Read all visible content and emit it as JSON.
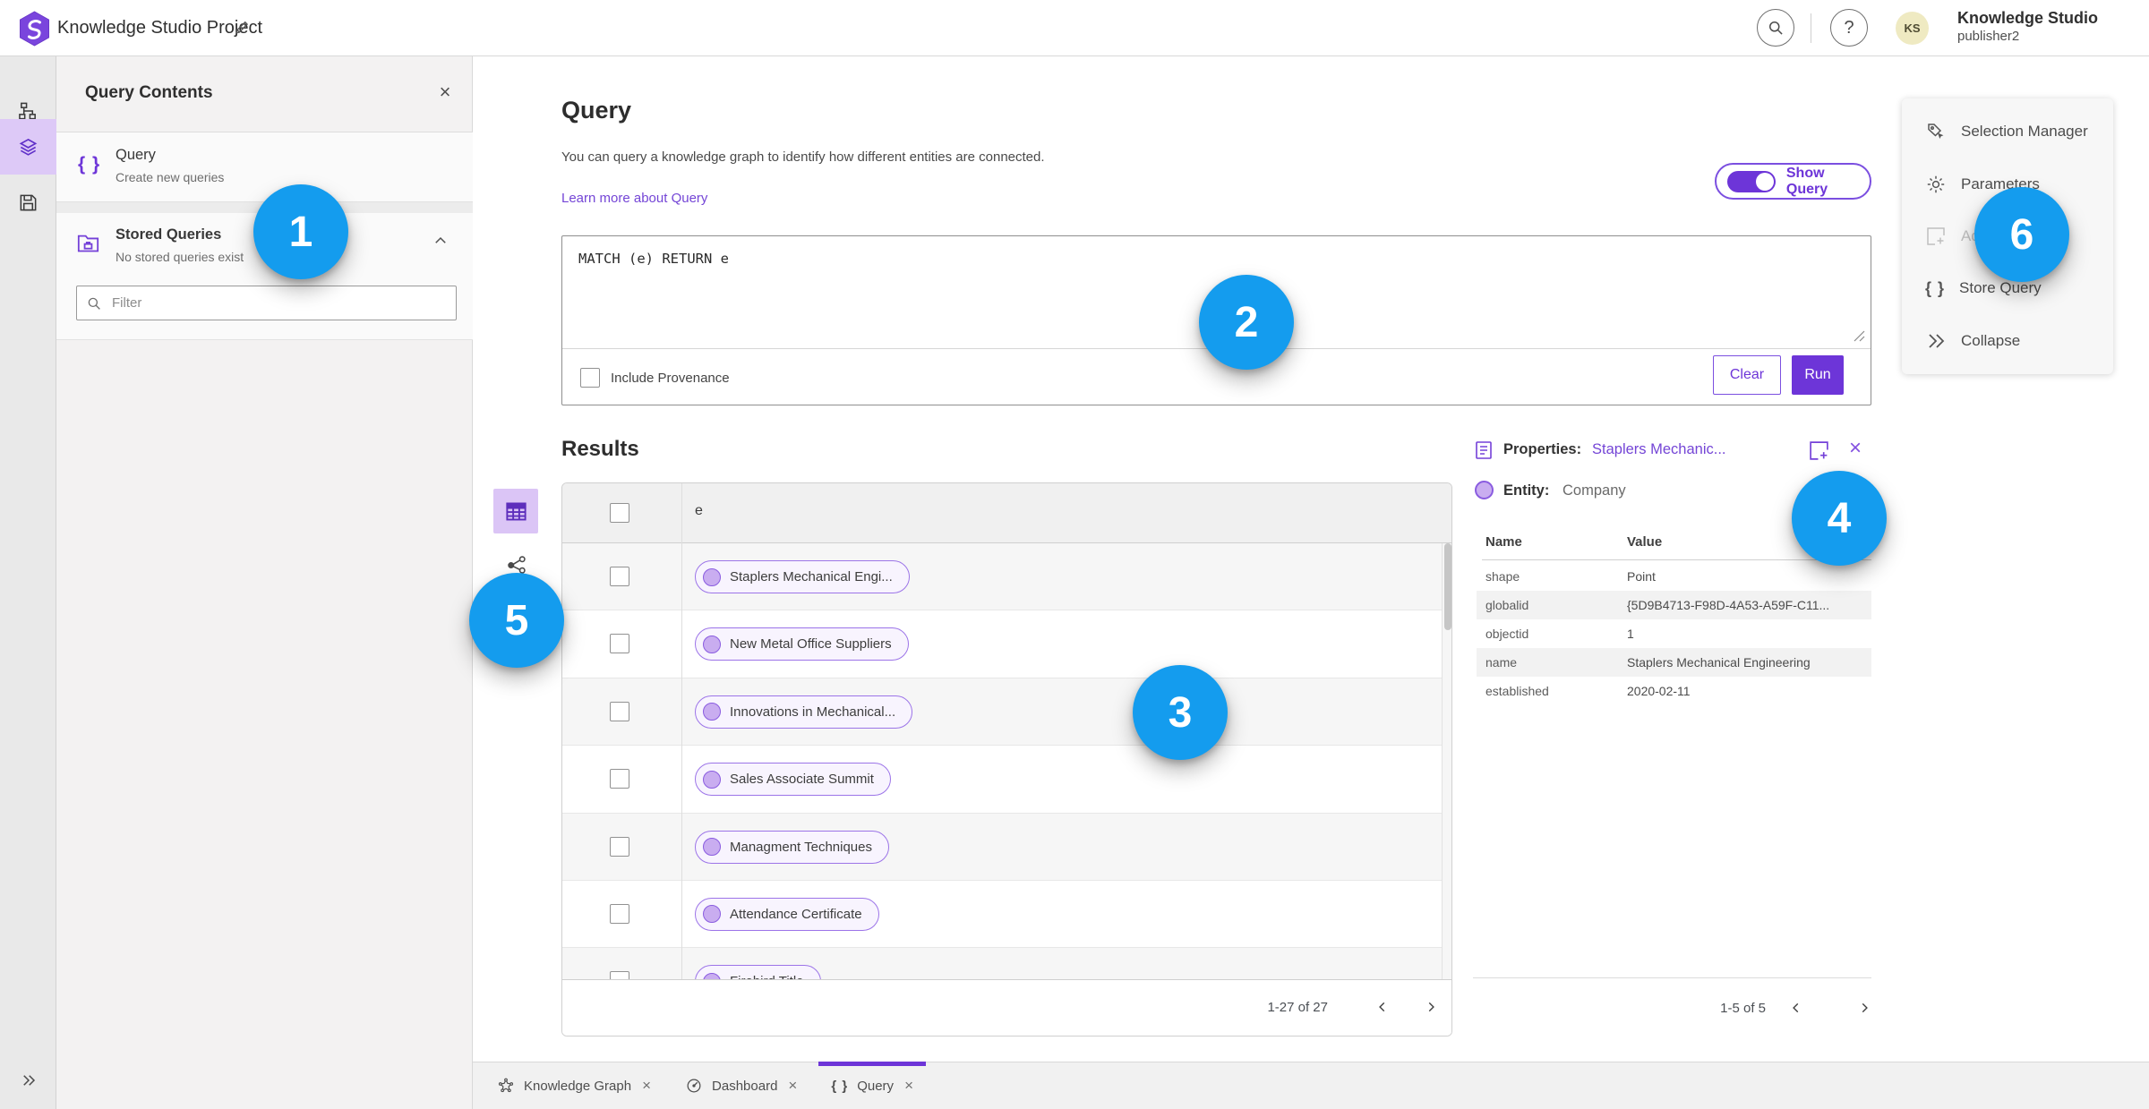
{
  "app": {
    "title": "Knowledge Studio Project",
    "user_initials": "KS",
    "user_name": "Knowledge Studio",
    "user_role": "publisher2"
  },
  "left_panel": {
    "title": "Query Contents",
    "query_item": {
      "title": "Query",
      "subtitle": "Create new queries"
    },
    "stored_item": {
      "title": "Stored Queries",
      "subtitle": "No stored queries exist"
    },
    "filter_placeholder": "Filter"
  },
  "query_section": {
    "heading": "Query",
    "description": "You can query a knowledge graph to identify how different entities are connected.",
    "learn_link": "Learn more about Query",
    "show_query_label": "Show Query",
    "query_text": "MATCH (e) RETURN e",
    "provenance_label": "Include Provenance",
    "clear_label": "Clear",
    "run_label": "Run"
  },
  "results": {
    "heading": "Results",
    "column_header": "e",
    "rows": [
      "Staplers Mechanical Engi...",
      "New Metal Office Suppliers",
      "Innovations in Mechanical...",
      "Sales Associate Summit",
      "Managment Techniques",
      "Attendance Certificate",
      "Firebird Title"
    ],
    "pagination": "1-27 of 27"
  },
  "properties": {
    "label": "Properties:",
    "entity_link": "Staplers Mechanic...",
    "entity_label": "Entity:",
    "entity_type": "Company",
    "name_header": "Name",
    "value_header": "Value",
    "rows": [
      {
        "name": "shape",
        "value": "Point"
      },
      {
        "name": "globalid",
        "value": "{5D9B4713-F98D-4A53-A59F-C11..."
      },
      {
        "name": "objectid",
        "value": "1"
      },
      {
        "name": "name",
        "value": "Staplers Mechanical Engineering"
      },
      {
        "name": "established",
        "value": "2020-02-11"
      }
    ],
    "pagination": "1-5 of 5"
  },
  "tool_menu": {
    "items": [
      {
        "label": "Selection Manager",
        "icon": "selection-manager-icon",
        "disabled": false
      },
      {
        "label": "Parameters",
        "icon": "parameters-icon",
        "disabled": false
      },
      {
        "label": "Ad",
        "icon": "add-to-map-icon",
        "disabled": true
      },
      {
        "label": "Store Query",
        "icon": "braces-icon",
        "disabled": false
      },
      {
        "label": "Collapse",
        "icon": "collapse-icon",
        "disabled": false
      }
    ]
  },
  "bottom_tabs": [
    {
      "label": "Knowledge Graph",
      "icon": "knowledge-graph-icon",
      "active": false
    },
    {
      "label": "Dashboard",
      "icon": "dashboard-icon",
      "active": false
    },
    {
      "label": "Query",
      "icon": "braces-icon",
      "active": true
    }
  ],
  "annotations": [
    {
      "label": "1"
    },
    {
      "label": "2"
    },
    {
      "label": "3"
    },
    {
      "label": "4"
    },
    {
      "label": "5"
    },
    {
      "label": "6"
    }
  ],
  "colors": {
    "accent_purple": "#6d35d8",
    "link_purple": "#7445d6",
    "pill_border": "#9c74e8",
    "node_fill": "#c9adf0",
    "annotation_blue": "#149cee",
    "rail_selected_bg": "#ddc9f7"
  }
}
